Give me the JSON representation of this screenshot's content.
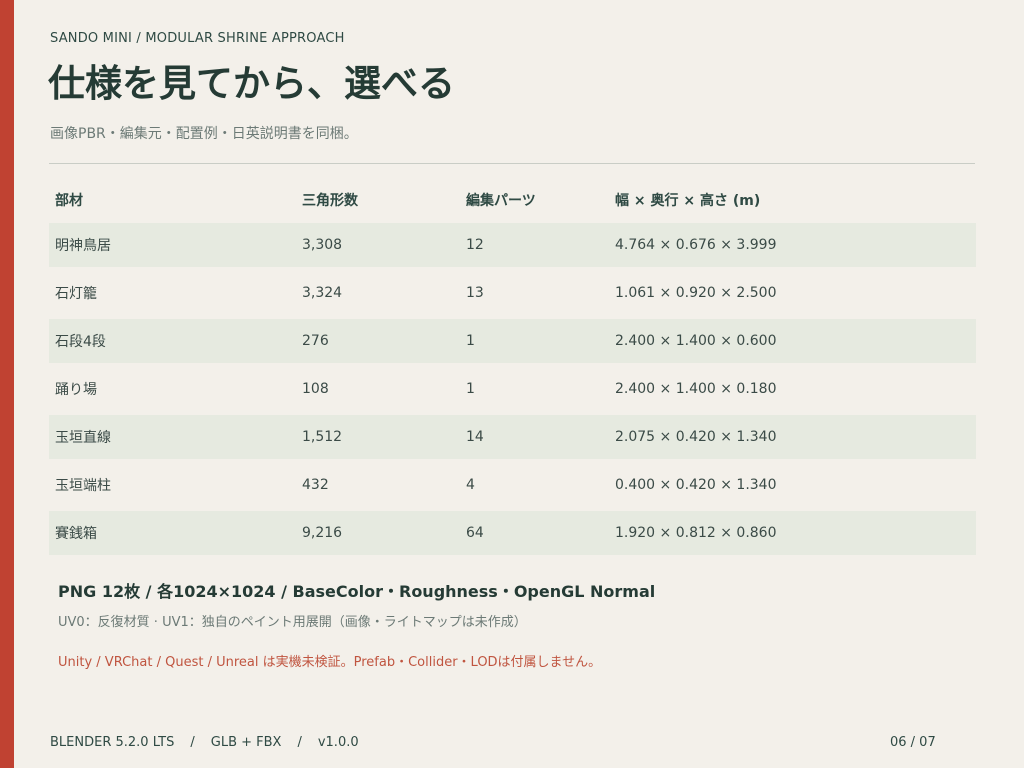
{
  "header": {
    "kicker": "SANDO MINI  /  MODULAR SHRINE APPROACH",
    "title": "仕様を見てから、選べる",
    "subtitle": "画像PBR・編集元・配置例・日英説明書を同梱。"
  },
  "table": {
    "headers": {
      "part": "部材",
      "triangles": "三角形数",
      "edit_parts": "編集パーツ",
      "dimensions": "幅 × 奥行 × 高さ (m)"
    },
    "rows": [
      {
        "part": "明神鳥居",
        "triangles": "3,308",
        "edit_parts": "12",
        "dimensions": "4.764 × 0.676 × 3.999"
      },
      {
        "part": "石灯籠",
        "triangles": "3,324",
        "edit_parts": "13",
        "dimensions": "1.061 × 0.920 × 2.500"
      },
      {
        "part": "石段4段",
        "triangles": "276",
        "edit_parts": "1",
        "dimensions": "2.400 × 1.400 × 0.600"
      },
      {
        "part": "踊り場",
        "triangles": "108",
        "edit_parts": "1",
        "dimensions": "2.400 × 1.400 × 0.180"
      },
      {
        "part": "玉垣直線",
        "triangles": "1,512",
        "edit_parts": "14",
        "dimensions": "2.075 × 0.420 × 1.340"
      },
      {
        "part": "玉垣端柱",
        "triangles": "432",
        "edit_parts": "4",
        "dimensions": "0.400 × 0.420 × 1.340"
      },
      {
        "part": "賽銭箱",
        "triangles": "9,216",
        "edit_parts": "64",
        "dimensions": "1.920 × 0.812 × 0.860"
      }
    ]
  },
  "notes": {
    "textures": "PNG 12枚 / 各1024×1024 / BaseColor・Roughness・OpenGL Normal",
    "uv": "UV0：反復材質  ·  UV1：独自のペイント用展開（画像・ライトマップは未作成）",
    "warning": "Unity / VRChat / Quest / Unreal は実機未検証。Prefab・Collider・LODは付属しません。"
  },
  "footer": {
    "version_blender": "BLENDER 5.2.0 LTS",
    "separator": "/",
    "formats": "GLB + FBX",
    "release": "v1.0.0",
    "page": "06 / 07"
  },
  "colors": {
    "accent_bar": "#c04232",
    "background": "#f3f0ea",
    "row_shade": "#e6eae0",
    "warning_text": "#c05540"
  }
}
